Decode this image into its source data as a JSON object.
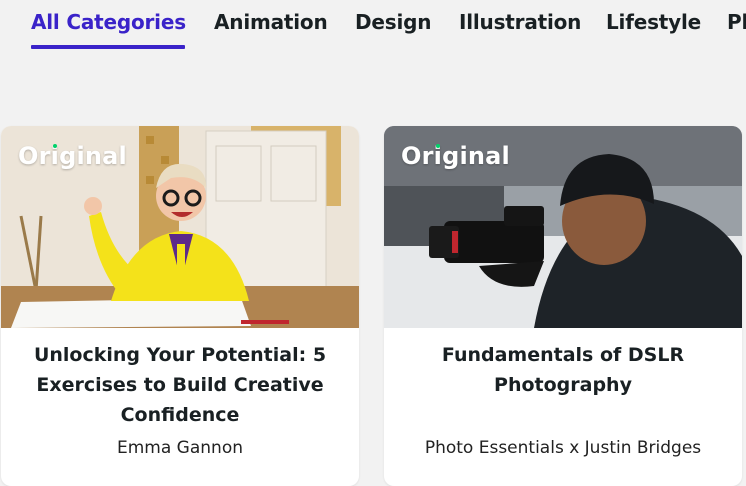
{
  "tabs": [
    {
      "label": "All Categories",
      "active": true
    },
    {
      "label": "Animation",
      "active": false
    },
    {
      "label": "Design",
      "active": false
    },
    {
      "label": "Illustration",
      "active": false
    },
    {
      "label": "Lifestyle",
      "active": false
    },
    {
      "label": "Pl",
      "active": false
    }
  ],
  "colors": {
    "accent": "#3a23c9",
    "badge_dot": "#00d26a",
    "card_background": "#ffffff",
    "page_background": "#f2f2f2"
  },
  "cards": [
    {
      "badge": "Original",
      "title": "Unlocking Your Potential: 5 Exercises to Build Creative Confidence",
      "author": "Emma Gannon"
    },
    {
      "badge": "Original",
      "title": "Fundamentals of DSLR Photography",
      "author": "Photo Essentials x Justin Bridges"
    }
  ]
}
